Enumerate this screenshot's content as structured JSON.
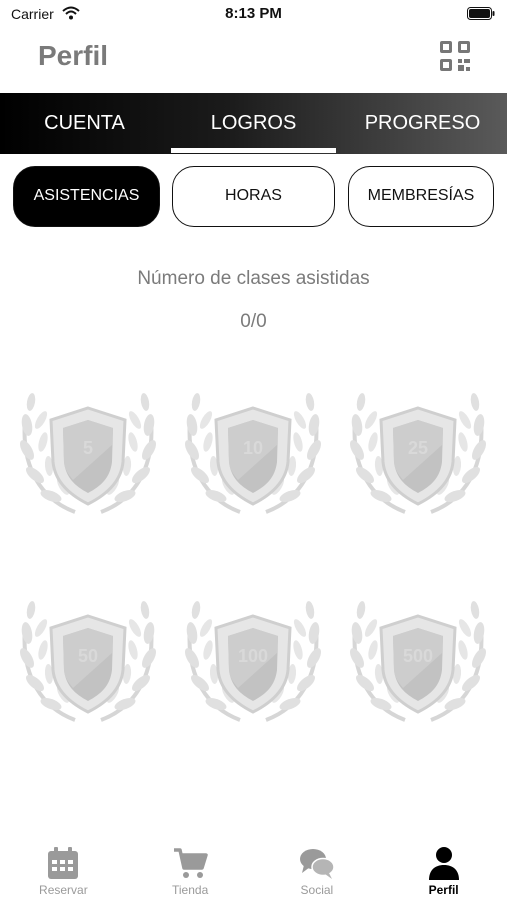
{
  "status_bar": {
    "carrier": "Carrier",
    "time": "8:13 PM"
  },
  "header": {
    "title": "Perfil",
    "qr_icon": "qr-code-icon"
  },
  "top_tabs": [
    {
      "label": "CUENTA",
      "active": false
    },
    {
      "label": "LOGROS",
      "active": true
    },
    {
      "label": "PROGRESO",
      "active": false
    }
  ],
  "segments": [
    {
      "label": "ASISTENCIAS",
      "active": true
    },
    {
      "label": "HORAS",
      "active": false
    },
    {
      "label": "MEMBRESÍAS",
      "active": false
    }
  ],
  "stats": {
    "label": "Número de clases asistidas",
    "value": "0/0"
  },
  "badges": [
    {
      "value": "5"
    },
    {
      "value": "10"
    },
    {
      "value": "25"
    },
    {
      "value": "50"
    },
    {
      "value": "100"
    },
    {
      "value": "500"
    }
  ],
  "bottom_nav": [
    {
      "label": "Reservar",
      "icon": "calendar-icon",
      "active": false
    },
    {
      "label": "Tienda",
      "icon": "cart-icon",
      "active": false
    },
    {
      "label": "Social",
      "icon": "chat-bubbles-icon",
      "active": false
    },
    {
      "label": "Perfil",
      "icon": "user-icon",
      "active": true
    }
  ],
  "colors": {
    "active_tab_bg": "#000000",
    "badge_gray": "#cfcfcf",
    "inactive_nav": "#9a9a9a"
  }
}
